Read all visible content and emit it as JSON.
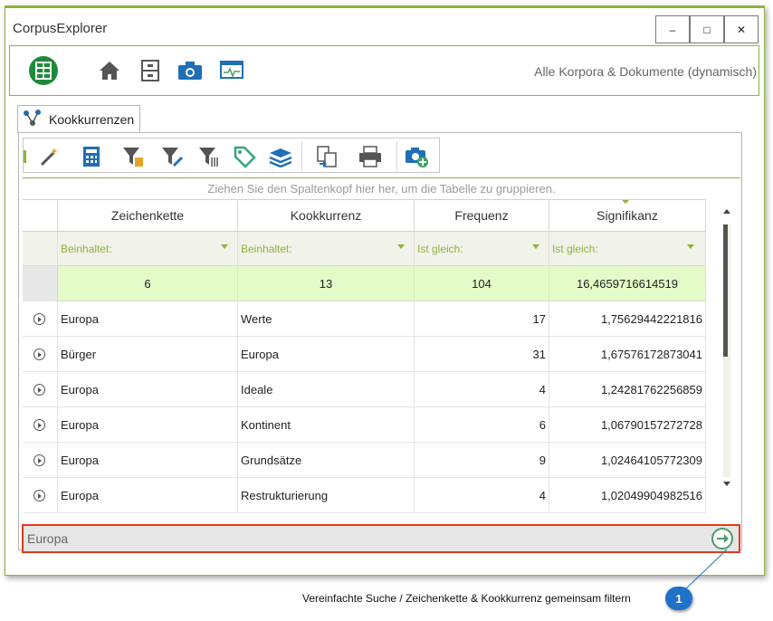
{
  "window": {
    "title": "CorpusExplorer",
    "controls": {
      "minimize": "‒",
      "maximize": "□",
      "close": "✕"
    }
  },
  "toolbar": {
    "icons": [
      "corpus-icon",
      "home-icon",
      "cabinet-icon",
      "camera-icon",
      "monitor-icon"
    ],
    "scope_label": "Alle Korpora & Dokumente (dynamisch)"
  },
  "tab": {
    "label": "Kookkurrenzen"
  },
  "grid_tools": {
    "icons": [
      "wand-icon",
      "calculator-icon",
      "filter-doc-icon",
      "filter-edit-icon",
      "filter-clear-icon",
      "tag-icon",
      "layers-icon",
      "export-icon",
      "print-icon",
      "snapshot-icon"
    ]
  },
  "grid": {
    "group_hint": "Ziehen Sie den Spaltenkopf hier her, um die Tabelle zu gruppieren.",
    "columns": [
      "Zeichenkette",
      "Kookkurrenz",
      "Frequenz",
      "Signifikanz"
    ],
    "filters": [
      "Beinhaltet:",
      "Beinhaltet:",
      "Ist gleich:",
      "Ist gleich:"
    ],
    "summary": [
      "6",
      "13",
      "104",
      "16,4659716614519"
    ],
    "rows": [
      {
        "zeichenkette": "Europa",
        "kookkurrenz": "Werte",
        "frequenz": "17",
        "signifikanz": "1,75629442221816"
      },
      {
        "zeichenkette": "Bürger",
        "kookkurrenz": "Europa",
        "frequenz": "31",
        "signifikanz": "1,67576172873041"
      },
      {
        "zeichenkette": "Europa",
        "kookkurrenz": "Ideale",
        "frequenz": "4",
        "signifikanz": "1,24281762256859"
      },
      {
        "zeichenkette": "Europa",
        "kookkurrenz": "Kontinent",
        "frequenz": "6",
        "signifikanz": "1,06790157272728"
      },
      {
        "zeichenkette": "Europa",
        "kookkurrenz": "Grundsätze",
        "frequenz": "9",
        "signifikanz": "1,02464105772309"
      },
      {
        "zeichenkette": "Europa",
        "kookkurrenz": "Restrukturierung",
        "frequenz": "4",
        "signifikanz": "1,02049904982516"
      }
    ]
  },
  "search": {
    "value": "Europa"
  },
  "callout": {
    "number": "1",
    "text": "Vereinfachte Suche / Zeichenkette & Kookkurrenz gemeinsam filtern"
  },
  "colors": {
    "accent": "#8cb43c",
    "highlight": "#e03a1a",
    "callout": "#1f72c8",
    "summary_bg": "#e2fbc8"
  }
}
